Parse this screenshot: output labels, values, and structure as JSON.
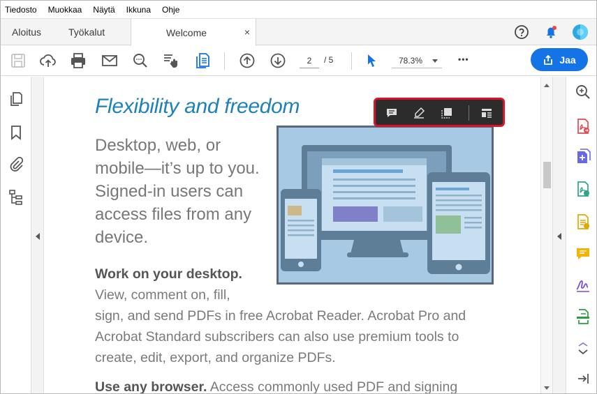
{
  "menu": [
    "Tiedosto",
    "Muokkaa",
    "Näytä",
    "Ikkuna",
    "Ohje"
  ],
  "tabs": {
    "home": "Aloitus",
    "tools": "Työkalut",
    "document": "Welcome",
    "close_glyph": "×"
  },
  "toolbar": {
    "page_current": "2",
    "page_total": "/ 5",
    "zoom": "78.3%",
    "share_label": "Jaa",
    "more_glyph": "•••"
  },
  "document": {
    "title": "Flexibility and freedom",
    "lead_text": "Desktop, web, or mobile—it’s up to you. Signed-in users can access files from any device.",
    "section1_heading": "Work on your desktop.",
    "section1_body_short": "View, comment on, fill,",
    "section1_body_rest": "sign, and send PDFs in free Acrobat Reader. Acrobat Pro and Acrobat Standard subscribers can also use premium tools to create, edit, export, and organize PDFs.",
    "section2_heading": "Use any browser.",
    "section2_body": "Access commonly used PDF and signing"
  },
  "colors": {
    "accent": "#1473e6",
    "title_blue": "#1e82b8",
    "highlight_border": "#d8132a",
    "illustration_bg": "#a8c9e3"
  },
  "icons": {
    "left_rail": [
      "page-thumbnails-icon",
      "bookmark-icon",
      "attachment-icon",
      "layers-icon"
    ],
    "right_rail": [
      "zoom-search-icon",
      "export-pdf-icon",
      "create-pdf-icon",
      "edit-pdf-icon",
      "organize-pages-icon",
      "comment-icon",
      "fill-sign-icon",
      "scan-icon",
      "more-tools-icon",
      "collapse-panel-icon"
    ]
  }
}
